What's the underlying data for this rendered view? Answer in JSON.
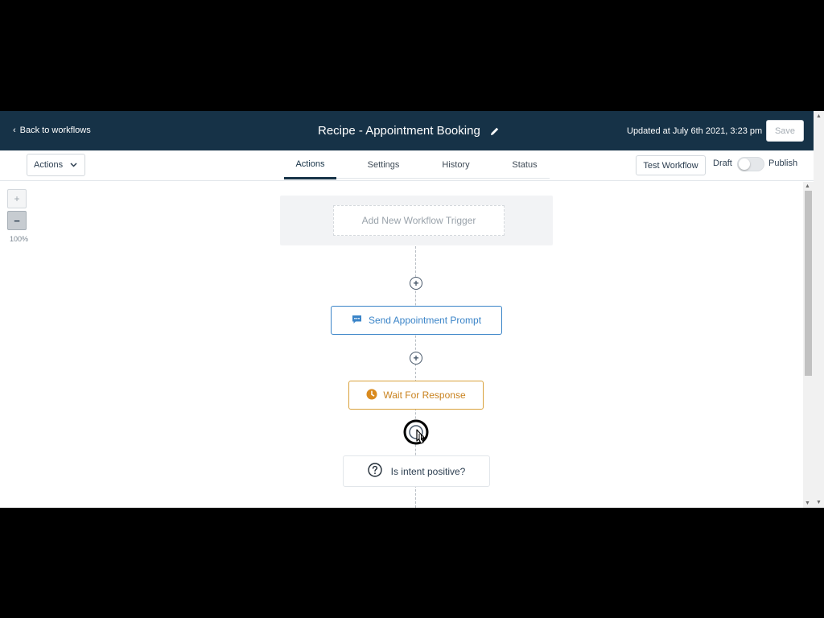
{
  "header": {
    "back_label": "Back to workflows",
    "title": "Recipe - Appointment Booking",
    "updated": "Updated at July 6th 2021, 3:23 pm",
    "save_label": "Save"
  },
  "toolbar": {
    "actions_label": "Actions",
    "tabs": [
      {
        "label": "Actions",
        "active": true
      },
      {
        "label": "Settings",
        "active": false
      },
      {
        "label": "History",
        "active": false
      },
      {
        "label": "Status",
        "active": false
      }
    ],
    "test_label": "Test Workflow",
    "draft_label": "Draft",
    "publish_label": "Publish",
    "published": false
  },
  "canvas": {
    "zoom_in": "+",
    "zoom_out": "−",
    "zoom_level": "100%",
    "trigger_label": "Add New Workflow Trigger",
    "add_step_symbol": "+",
    "nodes": [
      {
        "label": "Send Appointment Prompt",
        "icon": "chat-icon",
        "color": "#3a84c8"
      },
      {
        "label": "Wait For Response",
        "icon": "clock-icon",
        "color": "#c9821e"
      },
      {
        "label": "Is intent positive?",
        "icon": "question-icon",
        "color": "#2c3e50"
      }
    ]
  },
  "colors": {
    "header_bg": "#163247",
    "accent_blue": "#3a84c8",
    "accent_orange": "#d9a13b"
  }
}
